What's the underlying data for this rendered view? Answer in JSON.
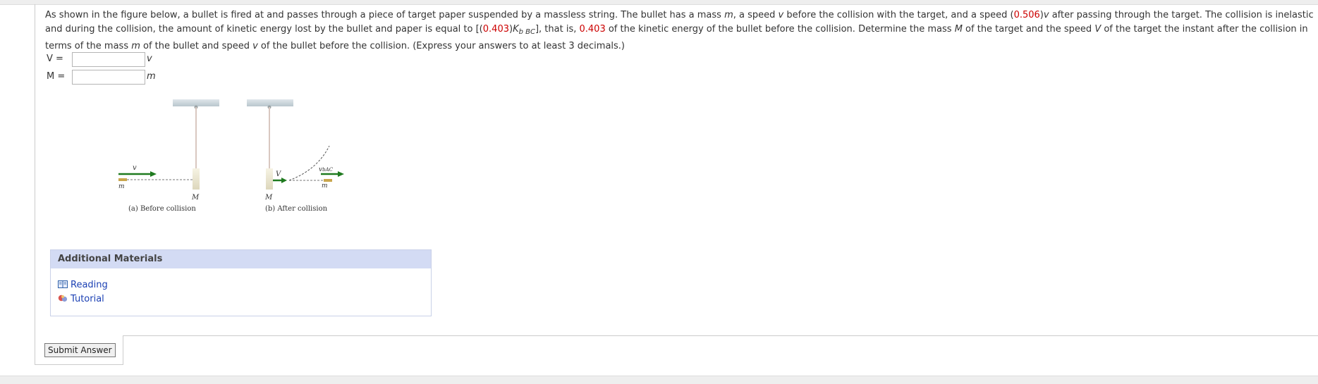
{
  "question": {
    "p1": "As shown in the figure below, a bullet is fired at and passes through a piece of target paper suspended by a massless string. The bullet has a mass ",
    "m": "m",
    "p2": ", a speed ",
    "v": "v",
    "p3": " before the collision with the target, and a speed (",
    "speed_factor": "0.506",
    "p4": ")",
    "p5": " after passing through the target. The collision is inelastic and during the collision, the amount of kinetic energy lost by the bullet and paper is equal to [(",
    "ke_factor": "0.403",
    "p6": ")",
    "K": "K",
    "K_sub": "b BC",
    "p7": "], that is, ",
    "ke_factor_2": "0.403",
    "p8": " of the kinetic energy of the bullet before the collision. Determine the mass ",
    "M": "M",
    "p9": " of the target and the speed ",
    "V": "V",
    "p10": " of the target the instant after the collision in terms of the mass ",
    "p11": " of the bullet and speed ",
    "p12": " of the bullet before the collision. (Express your answers to at least 3 decimals.)"
  },
  "answers": [
    {
      "label": "V =",
      "value": "",
      "unit": "v"
    },
    {
      "label": "M =",
      "value": "",
      "unit": "m"
    }
  ],
  "figure": {
    "a": {
      "v_label": "v",
      "m_label": "m",
      "M_label": "M",
      "caption": "(a) Before collision"
    },
    "b": {
      "V_label": "V",
      "vbac_label": "v",
      "vbac_sub": "bAC",
      "m_label": "m",
      "M_label": "M",
      "caption": "(b) After collision"
    }
  },
  "materials": {
    "title": "Additional Materials",
    "links": [
      {
        "label": "Reading",
        "icon": "book-icon"
      },
      {
        "label": "Tutorial",
        "icon": "tutorial-icon"
      }
    ]
  },
  "submit_label": "Submit Answer",
  "colors": {
    "red_value": "#cc0000",
    "link": "#1a3fb3",
    "header_bg": "#d3dbf4",
    "arrow": "#1f7a1f"
  }
}
